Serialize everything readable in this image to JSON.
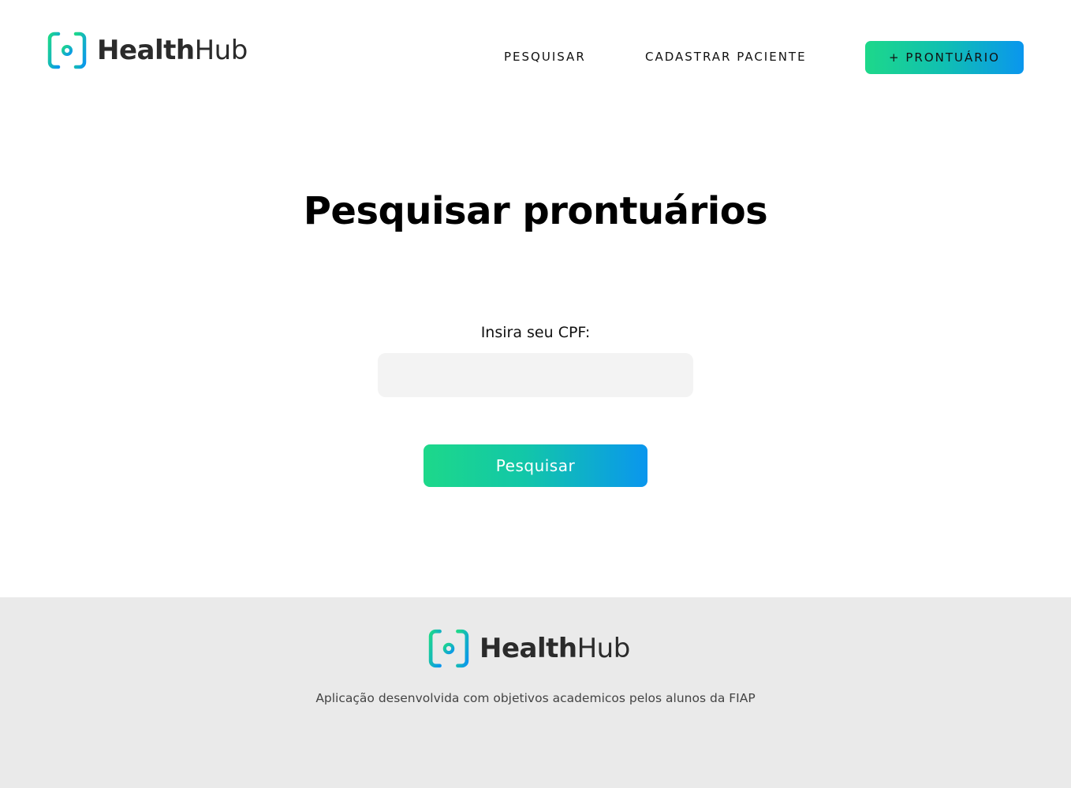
{
  "brand": {
    "name_bold": "Health",
    "name_light": "Hub",
    "colors": {
      "gradient_start": "#1dd88a",
      "gradient_end": "#0a96ee",
      "text_dark": "#2b2b2b"
    }
  },
  "header": {
    "nav": {
      "search_label": "PESQUISAR",
      "register_label": "CADASTRAR PACIENTE",
      "cta_label": "+ PRONTUÁRIO"
    }
  },
  "main": {
    "title": "Pesquisar prontuários",
    "cpf_label": "Insira seu CPF:",
    "cpf_value": "",
    "search_button_label": "Pesquisar"
  },
  "footer": {
    "description": "Aplicação desenvolvida com objetivos academicos pelos alunos da FIAP",
    "background": "#eaeaea"
  },
  "icons": {
    "logo": "healthhub-logo-icon"
  }
}
